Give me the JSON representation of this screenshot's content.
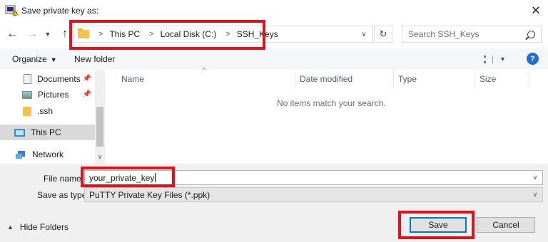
{
  "window": {
    "title": "Save private key as:"
  },
  "address": {
    "crumbs": [
      "This PC",
      "Local Disk (C:)",
      "SSH_Keys"
    ]
  },
  "search": {
    "placeholder": "Search SSH_Keys"
  },
  "toolbar": {
    "organize": "Organize",
    "new_folder": "New folder"
  },
  "sidebar": {
    "items": [
      {
        "label": "Documents",
        "icon": "documents-icon",
        "pinned": true
      },
      {
        "label": "Pictures",
        "icon": "pictures-icon",
        "pinned": true
      },
      {
        "label": ".ssh",
        "icon": "folder-icon",
        "pinned": false
      },
      {
        "label": "This PC",
        "icon": "this-pc-icon",
        "selected": true
      },
      {
        "label": "Network",
        "icon": "network-icon"
      }
    ]
  },
  "columns": [
    "Name",
    "Date modified",
    "Type",
    "Size"
  ],
  "empty_message": "No items match your search.",
  "form": {
    "file_name_label": "File name:",
    "file_name_value": "your_private_key",
    "save_type_label": "Save as type:",
    "save_type_value": "PuTTY Private Key Files (*.ppk)"
  },
  "footer": {
    "hide_folders": "Hide Folders",
    "save": "Save",
    "cancel": "Cancel"
  },
  "colors": {
    "highlight": "#e0131b",
    "accent": "#0078d7",
    "folder": "#f3c34f"
  }
}
